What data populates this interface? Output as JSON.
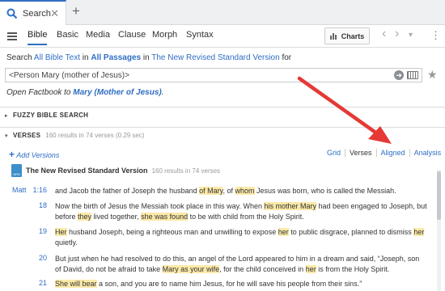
{
  "tab": {
    "label": "Search",
    "close": "✕",
    "new_tab": "+"
  },
  "toolbar": {
    "kinds": [
      "Bible",
      "Basic",
      "Media",
      "Clause",
      "Morph",
      "Syntax"
    ],
    "charts_label": "Charts",
    "back": "‹",
    "forward": "›",
    "dropdown": "▾",
    "more": "⋮"
  },
  "search": {
    "prefix": "Search",
    "scope": "All Bible Text",
    "in": "in",
    "passages": "All Passages",
    "in2": "in",
    "version": "The New Revised Standard Version",
    "for": "for",
    "query": "<Person Mary (mother of Jesus)>",
    "go": "➜",
    "star": "★"
  },
  "factbook": {
    "prefix": "Open Factbook to",
    "subject": "Mary (Mother of Jesus)",
    "suffix": "."
  },
  "sections": {
    "fuzzy": {
      "caret": "▸",
      "title": "FUZZY BIBLE SEARCH"
    },
    "verses": {
      "caret": "▾",
      "title": "VERSES",
      "summary": "160 results in 74 verses (0.29 sec)"
    }
  },
  "add_versions": {
    "plus": "+",
    "label": "Add Versions"
  },
  "views": [
    "Grid",
    "Verses",
    "Aligned",
    "Analysis"
  ],
  "version_row": {
    "badge": "NRS",
    "name": "The New Revised Standard Version",
    "count": "160 results in 74 verses"
  },
  "verses": [
    {
      "book": "Matt",
      "num": "1:16",
      "segments": [
        {
          "t": "and Jacob the father of Joseph the husband ",
          "h": false
        },
        {
          "t": "of Mary",
          "h": true
        },
        {
          "t": ", of ",
          "h": false
        },
        {
          "t": "whom",
          "h": true
        },
        {
          "t": " Jesus was born, who is called the Messiah.",
          "h": false
        }
      ]
    },
    {
      "book": "",
      "num": "18",
      "segments": [
        {
          "t": "Now the birth of Jesus the Messiah took place in this way. When ",
          "h": false
        },
        {
          "t": "his mother Mary",
          "h": true
        },
        {
          "t": " had been engaged to Joseph, but before ",
          "h": false
        },
        {
          "t": "they",
          "h": true
        },
        {
          "t": " lived together, ",
          "h": false
        },
        {
          "t": "she was found",
          "h": true
        },
        {
          "t": " to be with child from the Holy Spirit.",
          "h": false
        }
      ]
    },
    {
      "book": "",
      "num": "19",
      "segments": [
        {
          "t": "Her",
          "h": true
        },
        {
          "t": " husband Joseph, being a righteous man and unwilling to expose ",
          "h": false
        },
        {
          "t": "her",
          "h": true
        },
        {
          "t": " to public disgrace, planned to dismiss ",
          "h": false
        },
        {
          "t": "her",
          "h": true
        },
        {
          "t": " quietly.",
          "h": false
        }
      ]
    },
    {
      "book": "",
      "num": "20",
      "segments": [
        {
          "t": "But just when he had resolved to do this, an angel of the Lord appeared to him in a dream and said, “Joseph, son of David, do not be afraid to take ",
          "h": false
        },
        {
          "t": "Mary as your wife",
          "h": true
        },
        {
          "t": ", for the child conceived in ",
          "h": false
        },
        {
          "t": "her",
          "h": true
        },
        {
          "t": " is from the Holy Spirit.",
          "h": false
        }
      ]
    },
    {
      "book": "",
      "num": "21",
      "segments": [
        {
          "t": "She will bear",
          "h": true
        },
        {
          "t": " a son, and you are to name him Jesus, for he will save his people from their sins.”",
          "h": false
        }
      ]
    }
  ],
  "colors": {
    "accent": "#2f6ec4",
    "highlight": "#fbe9a8",
    "arrow": "#e53935"
  },
  "icons": [
    "search-icon",
    "close-icon",
    "plus-icon",
    "hamburger-icon",
    "chart-icon",
    "back-icon",
    "forward-icon",
    "go-icon",
    "keyboard-icon",
    "star-icon",
    "book-icon"
  ]
}
